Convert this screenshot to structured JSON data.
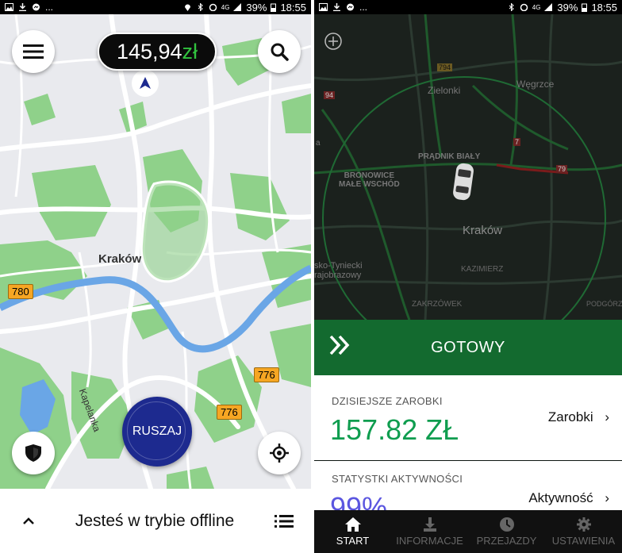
{
  "left_screen": {
    "statusbar": {
      "battery": "39%",
      "time": "18:55",
      "signal": "4G"
    },
    "earnings": {
      "amount": "145,94",
      "currency": "zł"
    },
    "map_labels": {
      "city": "Kraków",
      "street": "Kapelanka",
      "road_780": "780",
      "road_776a": "776",
      "road_776b": "776"
    },
    "go_button": "RUSZAJ",
    "status_text": "Jesteś w trybie offline"
  },
  "right_screen": {
    "statusbar": {
      "battery": "39%",
      "time": "18:55",
      "signal": "4G"
    },
    "map_labels": {
      "city": "Kraków",
      "zielonki": "Zielonki",
      "wegrzce": "Węgrzce",
      "pradnik": "PRĄDNIK BIAŁY",
      "bronowice": "BRONOWICE\nMAŁE WSCHÓD",
      "tyniecki": "sko-Tyniecki\nrajobrazowy",
      "kazimierz": "KAZIMIERZ",
      "zakrzowek": "ZAKRZÓWEK",
      "podgorze": "PODGÓRZ",
      "road_794": "794",
      "road_94": "94",
      "road_7": "7",
      "road_79": "79",
      "edge_a": "a"
    },
    "ready_button": "GOTOWY",
    "earnings_card": {
      "label": "DZISIEJSZE ZAROBKI",
      "value": "157.82 ZŁ",
      "link": "Zarobki"
    },
    "activity_card": {
      "label": "STATYSTKI AKTYWNOŚCI",
      "value": "99%",
      "link": "Aktywność"
    },
    "nav": [
      {
        "label": "START",
        "icon": "home-icon"
      },
      {
        "label": "INFORMACJE",
        "icon": "download-icon"
      },
      {
        "label": "PRZEJAZDY",
        "icon": "clock-icon"
      },
      {
        "label": "USTAWIENIA",
        "icon": "gear-icon"
      }
    ]
  },
  "colors": {
    "map_green": "#8fd18a",
    "river_blue": "#6aa6e6",
    "earnings_green": "#0f9d4f",
    "activity_purple": "#5b56e0",
    "ready_bar": "#136a2f",
    "go_button": "#1d2a8f",
    "road_badge": "#f6a623"
  }
}
